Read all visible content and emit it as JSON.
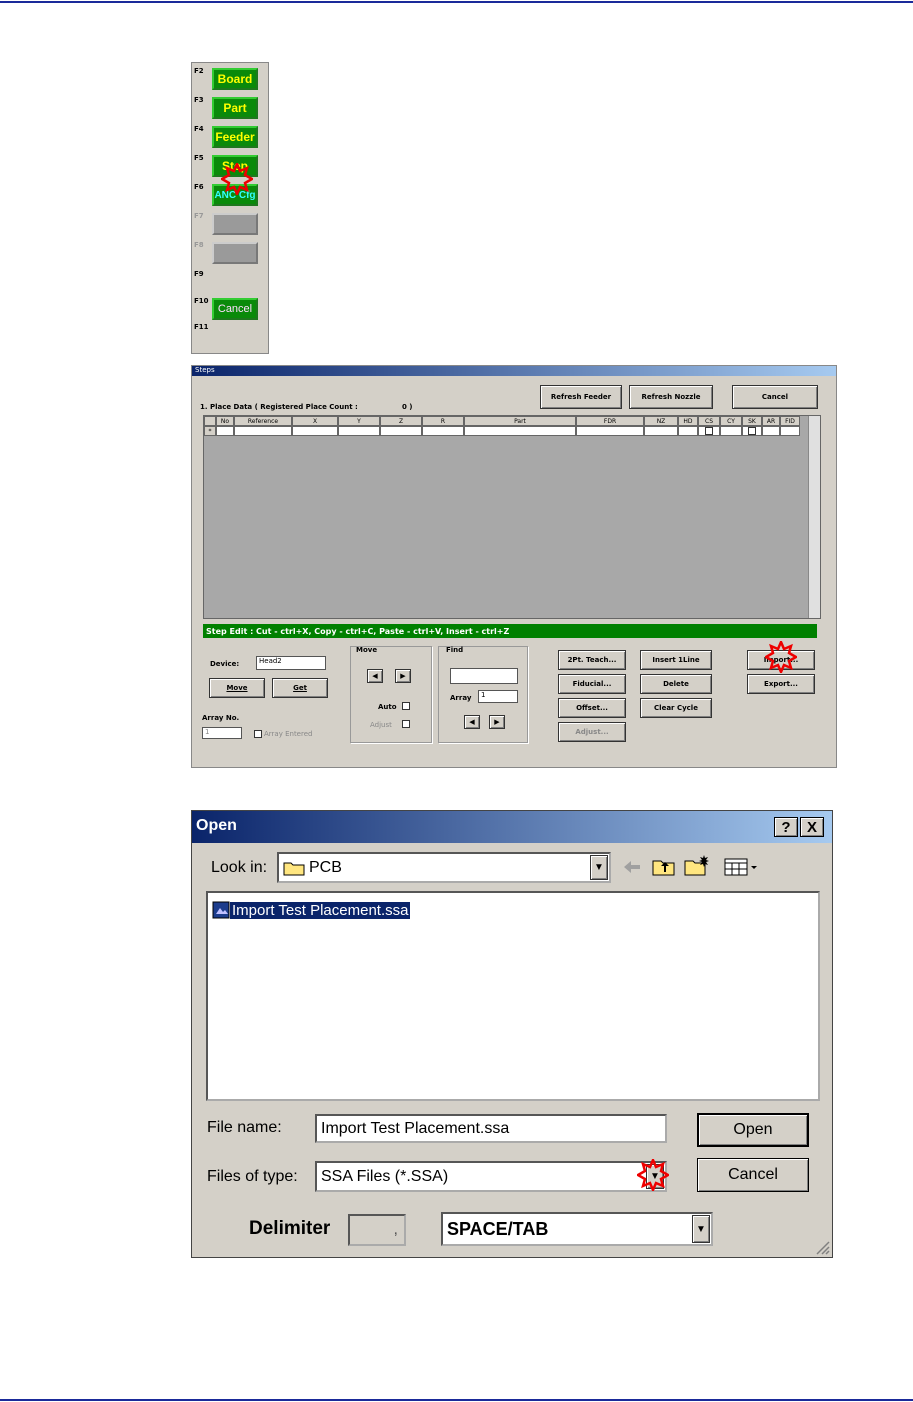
{
  "fkeys": [
    {
      "key": "F2",
      "label": "Board"
    },
    {
      "key": "F3",
      "label": "Part"
    },
    {
      "key": "F4",
      "label": "Feeder"
    },
    {
      "key": "F5",
      "label": "Step"
    },
    {
      "key": "F6",
      "label": "ANC Cfg"
    },
    {
      "key": "F7",
      "label": ""
    },
    {
      "key": "F8",
      "label": ""
    },
    {
      "key": "F9",
      "label": ""
    },
    {
      "key": "F10",
      "label": "Cancel"
    },
    {
      "key": "F11",
      "label": ""
    }
  ],
  "steps": {
    "title": "Steps",
    "place_data_label": "1. Place Data ( Registered Place Count :",
    "place_count": "0 )",
    "refresh_feeder": "Refresh Feeder",
    "refresh_nozzle": "Refresh Nozzle",
    "cancel": "Cancel",
    "columns": [
      "No",
      "Reference",
      "X",
      "Y",
      "Z",
      "R",
      "Part",
      "FDR",
      "NZ",
      "HD",
      "CS",
      "CY",
      "SK",
      "AR",
      "FID"
    ],
    "row_marker": "*",
    "status_bar": "Step Edit : Cut - ctrl+X,  Copy - ctrl+C,  Paste - ctrl+V,     Insert - ctrl+Z",
    "device_label": "Device:",
    "device_value": "Head2",
    "move_btn": "Move",
    "get_btn": "Get",
    "array_no_label": "Array No.",
    "array_no_value": "1",
    "array_entered": "Array Entered",
    "move_group": "Move",
    "auto_label": "Auto",
    "adjust_label": "Adjust",
    "find_group": "Find",
    "array_label": "Array",
    "array_value": "1",
    "teach_2pt": "2Pt. Teach...",
    "fiducial": "Fiducial...",
    "offset": "Offset...",
    "adjust_btn": "Adjust...",
    "insert_line": "Insert 1Line",
    "delete": "Delete",
    "clear_cycle": "Clear Cycle",
    "import": "Import...",
    "export": "Export..."
  },
  "open_dialog": {
    "title": "Open",
    "help": "?",
    "close": "X",
    "look_in_label": "Look in:",
    "look_in_value": "PCB",
    "files": [
      "Import Test Placement.ssa"
    ],
    "file_name_label": "File name:",
    "file_name_value": "Import Test Placement.ssa",
    "files_of_type_label": "Files of type:",
    "files_of_type_value": "SSA Files (*.SSA)",
    "open_button": "Open",
    "cancel_button": "Cancel",
    "delimiter_label": "Delimiter",
    "delimiter_char": ",",
    "delimiter_value": "SPACE/TAB"
  }
}
